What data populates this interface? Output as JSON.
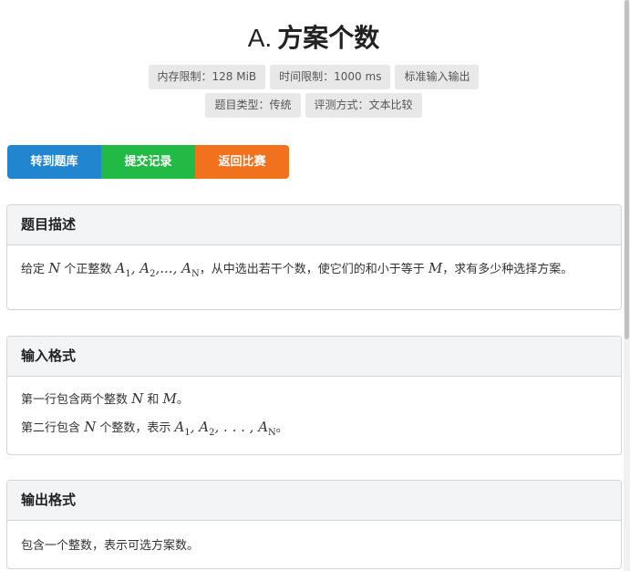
{
  "problem": {
    "prefix": "A.",
    "title": "方案个数"
  },
  "tags": [
    "内存限制：128 MiB",
    "时间限制：1000 ms",
    "标准输入输出",
    "题目类型：传统",
    "评测方式：文本比较"
  ],
  "buttons": {
    "goto_problemset": "转到题库",
    "submissions": "提交记录",
    "back_to_contest": "返回比赛"
  },
  "sections": {
    "description": {
      "header": "题目描述",
      "t1": "给定 ",
      "v1": "N",
      "t2": " 个正整数 ",
      "a": "A",
      "s1": "1",
      "s2": "2",
      "sN": "N",
      "c1": ", ",
      "c2": ",..., ",
      "t3": "，从中选出若干个数，使它们的和小于等于 ",
      "v2": "M",
      "t4": "，求有多少种选择方案。"
    },
    "input": {
      "header": "输入格式",
      "l1a": "第一行包含两个整数 ",
      "l1n": "N",
      "l1b": " 和 ",
      "l1m": "M",
      "l1c": "。",
      "l2a": "第二行包含 ",
      "l2n": "N",
      "l2b": " 个整数，表示 ",
      "a": "A",
      "s1": "1",
      "s2": "2",
      "sN": "N",
      "c1": ", ",
      "c2": ", . . . , ",
      "l2c": "。"
    },
    "output": {
      "header": "输出格式",
      "text": "包含一个整数，表示可选方案数。"
    }
  }
}
